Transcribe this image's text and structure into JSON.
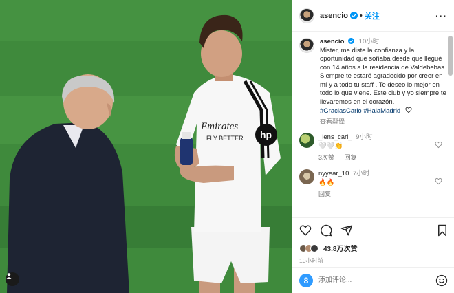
{
  "post": {
    "username": "asencio",
    "follow_label": "关注",
    "separator": "•",
    "more_icon": "more-icon"
  },
  "caption": {
    "username": "asencio",
    "time": "10小时",
    "text": "Mister, me diste la confianza y la oportunidad que soñaba desde que llegué con 14 años a la residencia de Valdebebas. Siempre te estaré agradecido por creer en mí y a todo tu staff . Te deseo lo mejor en todo lo que viene. Este club y yo siempre te llevaremos en el corazón.",
    "hashtags": "#GraciasCarlo #HalaMadrid",
    "translate": "查看翻译"
  },
  "comments": [
    {
      "username": "_lens_carl_",
      "time": "9小时",
      "text": "🤍🤍👏",
      "likes": "3次赞",
      "reply": "回复"
    },
    {
      "username": "nyyear_10",
      "time": "7小时",
      "text": "🔥🔥",
      "reply": "回复"
    }
  ],
  "actions": {
    "likes_count": "43.8万次赞",
    "posted_ago": "10小时前"
  },
  "comment_box": {
    "placeholder": "添加评论..."
  },
  "photo": {
    "jersey_text": "Emirates FLY BETTER",
    "sponsor": "hp"
  },
  "colors": {
    "accent": "#0095f6",
    "pitch": "#4c9a46",
    "badge": "#2f9bff"
  }
}
